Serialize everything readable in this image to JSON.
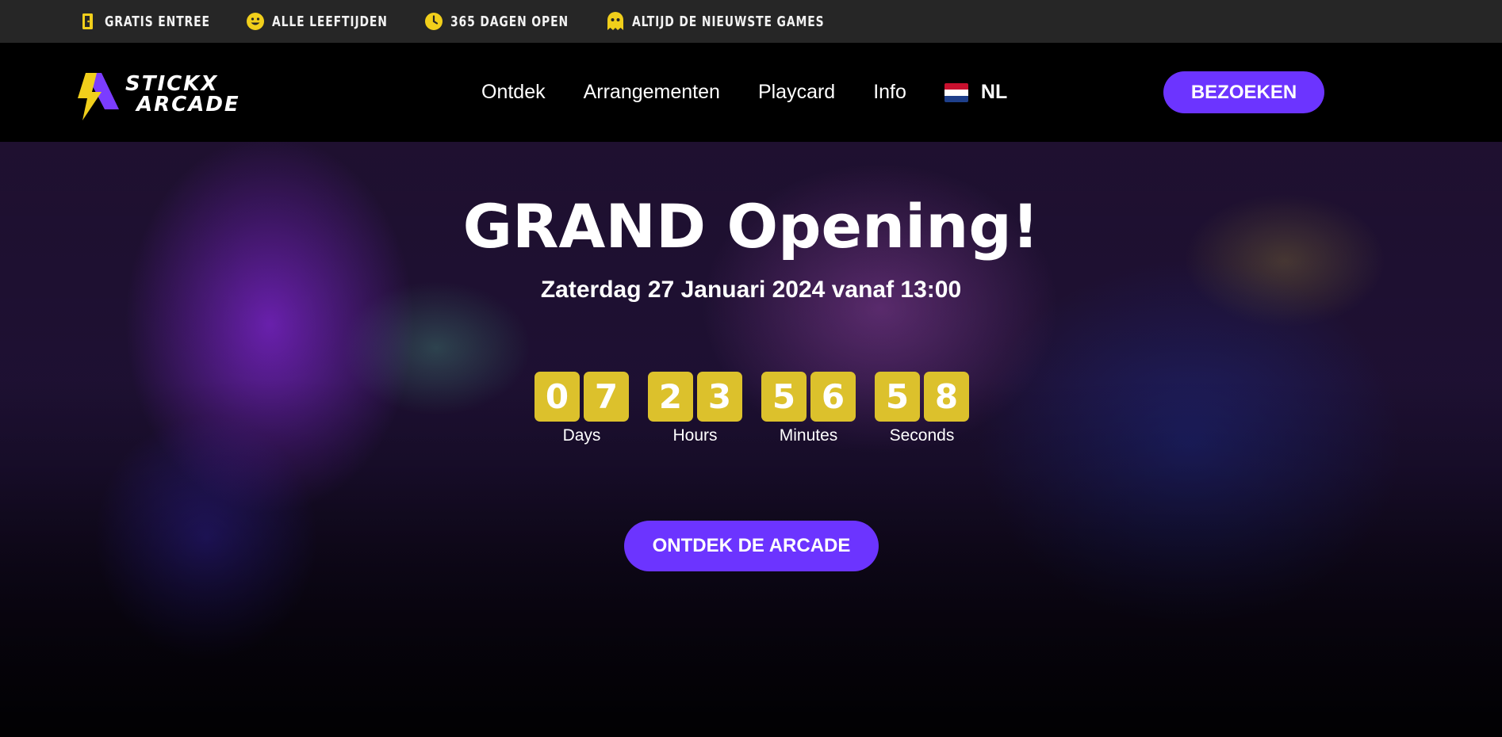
{
  "colors": {
    "accent_purple": "#6c34ff",
    "digit_yellow": "#dcc12c",
    "icon_yellow": "#f1cf1b",
    "topbar_bg": "#262626",
    "nav_bg": "#000000"
  },
  "topbar": {
    "items": [
      {
        "icon": "door-icon",
        "label": "GRATIS ENTREE"
      },
      {
        "icon": "smiley-icon",
        "label": "ALLE LEEFTIJDEN"
      },
      {
        "icon": "clock-icon",
        "label": "365 DAGEN OPEN"
      },
      {
        "icon": "ghost-icon",
        "label": "ALTIJD DE NIEUWSTE GAMES"
      }
    ]
  },
  "nav": {
    "logo": {
      "line1": "STICKX",
      "line2": "ARCADE"
    },
    "links": [
      "Ontdek",
      "Arrangementen",
      "Playcard",
      "Info"
    ],
    "language": {
      "flag": "netherlands-flag-icon",
      "label": "NL"
    },
    "cta": "BEZOEKEN"
  },
  "hero": {
    "title": "GRAND Opening!",
    "date": "Zaterdag 27 Januari 2024 vanaf 13:00",
    "countdown": [
      {
        "digits": [
          "0",
          "7"
        ],
        "label": "Days"
      },
      {
        "digits": [
          "2",
          "3"
        ],
        "label": "Hours"
      },
      {
        "digits": [
          "5",
          "6"
        ],
        "label": "Minutes"
      },
      {
        "digits": [
          "5",
          "8"
        ],
        "label": "Seconds"
      }
    ],
    "cta": "ONTDEK DE ARCADE"
  }
}
